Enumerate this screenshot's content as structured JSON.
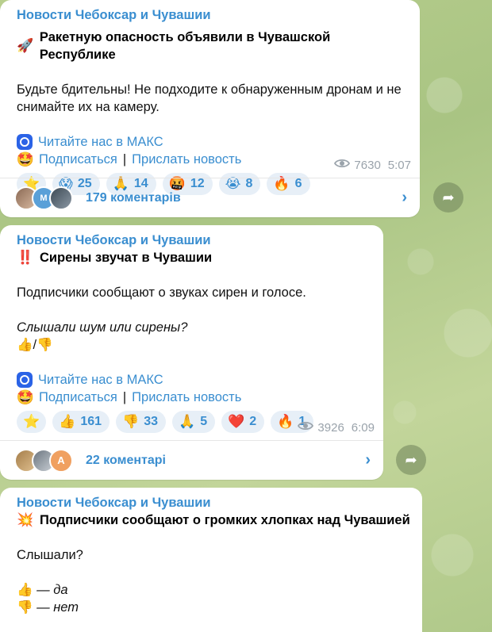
{
  "posts": [
    {
      "channel": "Новости Чебоксар и Чувашии",
      "title_emoji": "🚀",
      "title": "Ракетную опасность объявили в Чувашской Республике",
      "body": "Будьте бдительны! Не подходите к обнаруженным дронам и не снимайте их на камеру.",
      "maks_link": "Читайте нас в МАКС",
      "subscribe": "Подписаться",
      "separator": "|",
      "send_news": "Прислать новость",
      "reactions": [
        {
          "emoji": "⭐",
          "count": ""
        },
        {
          "emoji": "😱",
          "count": "25"
        },
        {
          "emoji": "🙏",
          "count": "14"
        },
        {
          "emoji": "🤬",
          "count": "12"
        },
        {
          "emoji": "😭",
          "count": "8"
        },
        {
          "emoji": "🔥",
          "count": "6"
        }
      ],
      "views": "7630",
      "time": "5:07",
      "comments": "179 коментарів"
    },
    {
      "channel": "Новости Чебоксар и Чувашии",
      "title_emoji": "‼️",
      "title": "Сирены звучат в Чувашии",
      "body": "Подписчики сообщают о звуках сирен и голосе.",
      "question": "Слышали шум или сирены?",
      "vote_line": "👍/👎",
      "maks_link": "Читайте нас в МАКС",
      "subscribe": "Подписаться",
      "separator": "|",
      "send_news": "Прислать новость",
      "reactions": [
        {
          "emoji": "⭐",
          "count": ""
        },
        {
          "emoji": "👍",
          "count": "161"
        },
        {
          "emoji": "👎",
          "count": "33"
        },
        {
          "emoji": "🙏",
          "count": "5"
        },
        {
          "emoji": "❤️",
          "count": "2"
        },
        {
          "emoji": "🔥",
          "count": "1"
        }
      ],
      "views": "3926",
      "time": "6:09",
      "comments": "22 коментарі"
    },
    {
      "channel": "Новости Чебоксар и Чувашии",
      "title_emoji": "💥",
      "title": "Подписчики сообщают о громких хлопках над Чувашией",
      "body": "Слышали?",
      "option_yes": "— да",
      "option_no": "— нет",
      "yes_emoji": "👍",
      "no_emoji": "👎"
    }
  ],
  "avatar_a_letter": "А",
  "avatar_m_letter": "М"
}
